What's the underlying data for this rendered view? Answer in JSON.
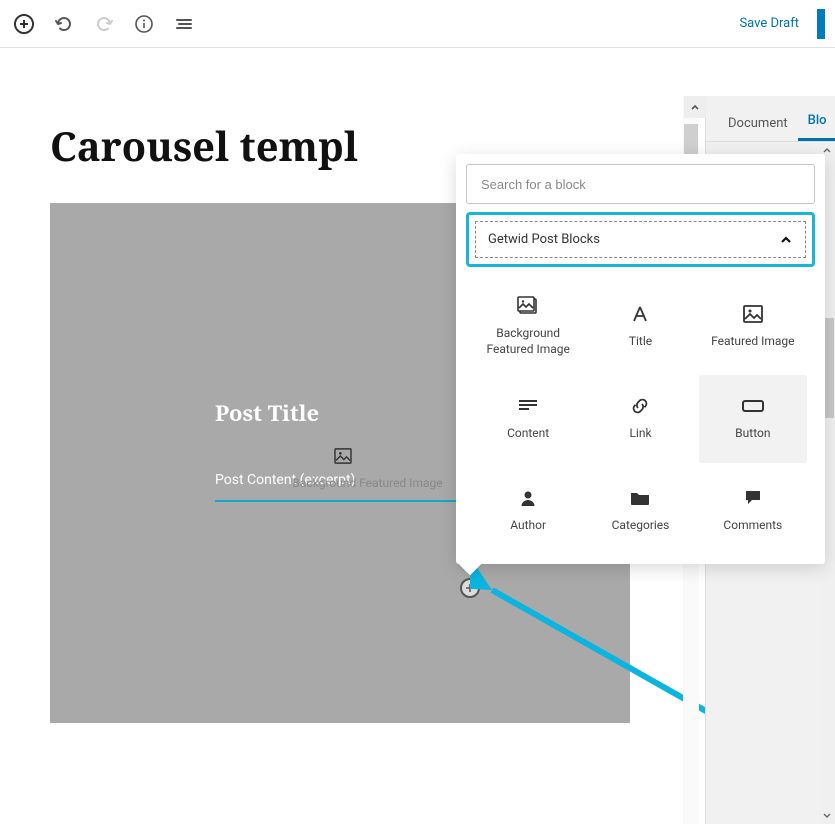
{
  "toolbar": {
    "save_draft": "Save Draft"
  },
  "sidebar_tabs": {
    "document": "Document",
    "block": "Blo"
  },
  "page": {
    "title": "Carousel templ"
  },
  "block": {
    "post_title": "Post Title",
    "post_excerpt": "Post Content (excerpt)",
    "bg_label": "Background Featured Image"
  },
  "inserter": {
    "search_placeholder": "Search for a block",
    "category": "Getwid Post Blocks",
    "blocks": [
      {
        "label": "Background Featured Image"
      },
      {
        "label": "Title"
      },
      {
        "label": "Featured Image"
      },
      {
        "label": "Content"
      },
      {
        "label": "Link"
      },
      {
        "label": "Button"
      },
      {
        "label": "Author"
      },
      {
        "label": "Categories"
      },
      {
        "label": "Comments"
      }
    ]
  }
}
